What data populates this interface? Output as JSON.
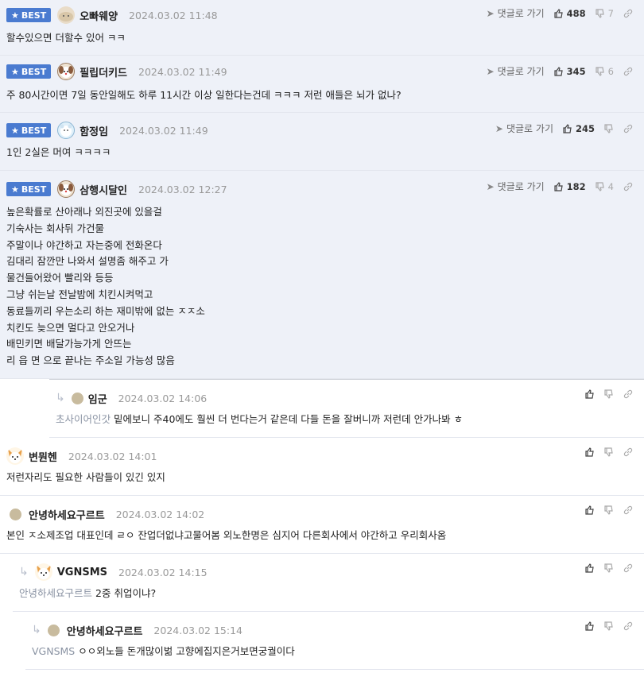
{
  "best_label": "BEST",
  "goto_label": "댓글로 가기",
  "comments": [
    {
      "nick": "오빠웨양",
      "date": "2024.03.02 11:48",
      "text": "할수있으면 더할수 있어 ㅋㅋ",
      "likes": "488",
      "dislikes": "7",
      "best": true
    },
    {
      "nick": "필립더키드",
      "date": "2024.03.02 11:49",
      "text": "주 80시간이면 7일 동안일해도 하루 11시간 이상 일한다는건데 ㅋㅋㅋ 저런 애들은 뇌가 없나?",
      "likes": "345",
      "dislikes": "6",
      "best": true
    },
    {
      "nick": "함정임",
      "date": "2024.03.02 11:49",
      "text": "1인 2실은 머여 ㅋㅋㅋㅋ",
      "likes": "245",
      "dislikes": "",
      "best": true
    },
    {
      "nick": "삼행시달인",
      "date": "2024.03.02 12:27",
      "lines": [
        "높은확률로 산아래나 외진곳에 있을걸",
        "기숙사는 회사뒤 가건물",
        "주말이나 야간하고 자는중에 전화온다",
        "김대리 잠깐만 나와서 설명좀 해주고 가",
        "물건들어왔어 빨리와 등등",
        "그냥 쉬는날 전날밤에 치킨시켜먹고",
        "동료들끼리 우는소리 하는 재미밖에 없는 ㅈㅈ소",
        "치킨도 늦으면 멀다고 안오거나",
        "배민키면 배달가능가게 안뜨는",
        "리 읍 면 으로 끝나는 주소일 가능성 많음"
      ],
      "likes": "182",
      "dislikes": "4",
      "best": true
    },
    {
      "nick": "임군",
      "date": "2024.03.02 14:06",
      "mention": "초사이어인갓",
      "text": "밑에보니 주40에도 훨씬 더 번다는거 같은데 다들 돈을 잘버니까 저런데 안가나봐 ㅎ"
    },
    {
      "nick": "변뭔헨",
      "date": "2024.03.02 14:01",
      "text": "저런자리도 필요한 사람들이 있긴 있지"
    },
    {
      "nick": "안녕하세요구르트",
      "date": "2024.03.02 14:02",
      "text": "본인 ㅈ소제조업 대표인데 ㄹㅇ 잔업더없냐고물어봄 외노한명은 심지어 다른회사에서 야간하고 우리회사옴"
    },
    {
      "nick": "VGNSMS",
      "date": "2024.03.02 14:15",
      "mention": "안녕하세요구르트",
      "text": "2중 취업이냐?"
    },
    {
      "nick": "안녕하세요구르트",
      "date": "2024.03.02 15:14",
      "mention": "VGNSMS",
      "text": "ㅇㅇ외노들 돈개많이벎 고향에집지은거보면궁궐이다"
    }
  ]
}
